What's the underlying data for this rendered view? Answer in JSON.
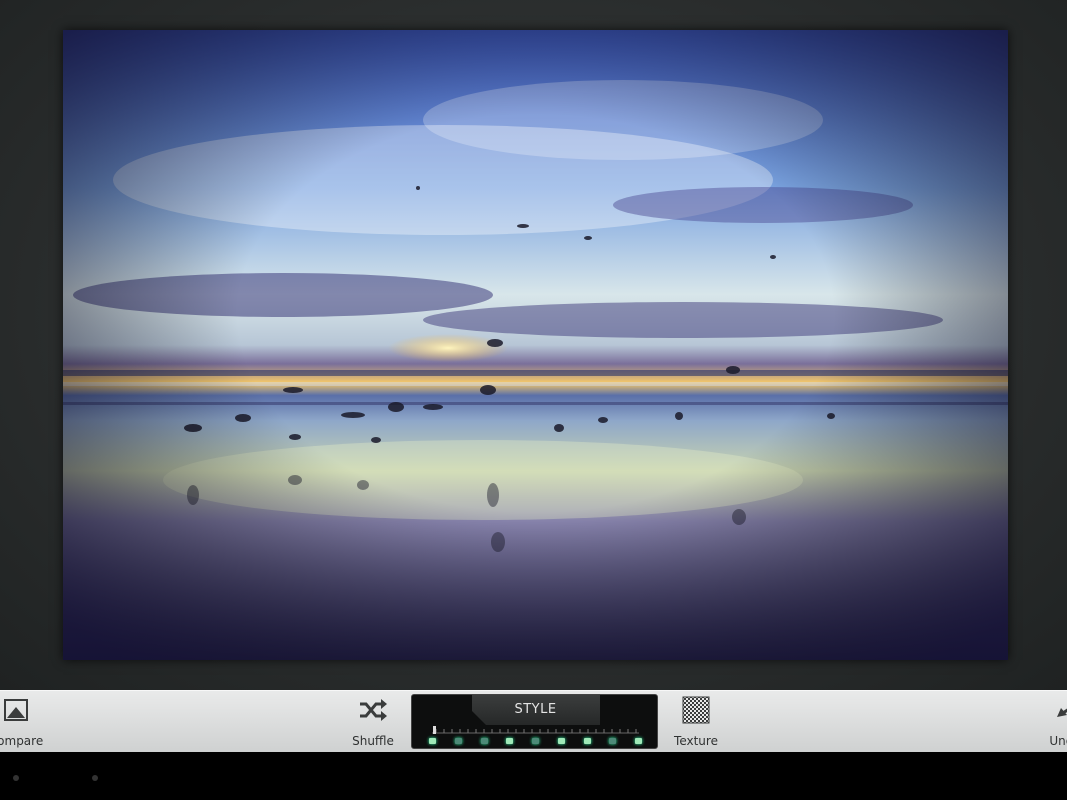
{
  "toolbar": {
    "compare_label": "Compare",
    "shuffle_label": "Shuffle",
    "texture_label": "Texture",
    "undo_label": "Undo",
    "style_title": "STYLE",
    "style_dots": 9
  },
  "icons": {
    "compare": "image-compare-icon",
    "shuffle": "shuffle-icon",
    "texture": "checkerboard-icon",
    "undo": "undo-arrow-icon"
  },
  "colors": {
    "toolbar_bg": "#dcdede",
    "panel_bg": "#0d0e0e",
    "dot_green": "#4d8a78",
    "dot_light": "#9fe9b8",
    "canvas_bg": "#2a2d2d"
  }
}
